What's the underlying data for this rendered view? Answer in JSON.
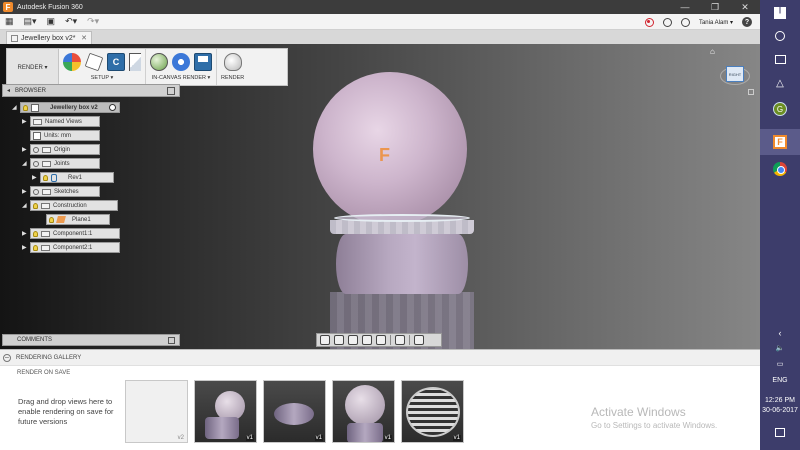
{
  "window": {
    "title": "Autodesk Fusion 360",
    "controls": [
      "—",
      "❐",
      "✕"
    ]
  },
  "quick_access": {
    "user_name": "Tania Alam ▾",
    "help_label": "?"
  },
  "document_tab": {
    "label": "Jewellery box v2*",
    "close": "✕"
  },
  "ribbon": {
    "workspace": "RENDER ▾",
    "groups": [
      {
        "label": "SETUP ▾"
      },
      {
        "label": "IN-CANVAS RENDER ▾"
      },
      {
        "label": "RENDER"
      }
    ],
    "cube_letter": "C"
  },
  "browser": {
    "title": "BROWSER",
    "root": "Jewellery box v2",
    "nodes": [
      {
        "label": "Named Views"
      },
      {
        "label": "Units: mm"
      },
      {
        "label": "Origin"
      },
      {
        "label": "Joints"
      },
      {
        "label": "Rev1"
      },
      {
        "label": "Sketches"
      },
      {
        "label": "Construction"
      },
      {
        "label": "Plane1"
      },
      {
        "label": "Component1:1"
      },
      {
        "label": "Component2:1"
      }
    ]
  },
  "viewcube": {
    "face": "RIGHT"
  },
  "comments": {
    "title": "COMMENTS"
  },
  "gallery": {
    "title": "RENDERING GALLERY",
    "render_on_save": "RENDER ON SAVE",
    "hint": "Drag and drop views here to enable rendering on save for future versions",
    "thumbnails": [
      {
        "version": "v2"
      },
      {
        "version": "v1"
      },
      {
        "version": "v1"
      },
      {
        "version": "v1"
      },
      {
        "version": "v1"
      }
    ]
  },
  "watermark": {
    "line1": "Activate Windows",
    "line2": "Go to Settings to activate Windows."
  },
  "taskbar": {
    "language": "ENG",
    "time": "12:26 PM",
    "date": "30-06-2017"
  },
  "colors": {
    "taskbar": "#3d3d6b",
    "fusion_orange": "#f08a2c",
    "title_bar": "#3c3c3c"
  }
}
